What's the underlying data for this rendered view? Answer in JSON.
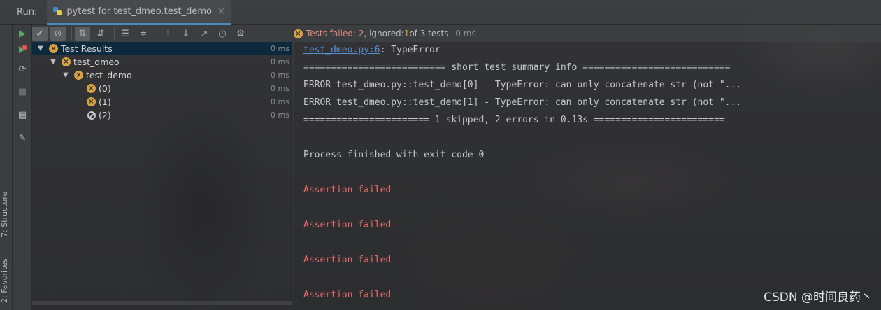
{
  "titlebar": {
    "run_label": "Run:",
    "tab_label": "pytest for test_dmeo.test_demo",
    "close_glyph": "×"
  },
  "side_tabs": {
    "structure": "7: Structure",
    "favorites": "2: Favorites"
  },
  "status": {
    "failed": "Tests failed: 2",
    "ignored_prefix": ", ignored: ",
    "ignored_num": "1",
    "rest": " of 3 tests",
    "time": " – 0 ms"
  },
  "tree": {
    "root": {
      "label": "Test Results",
      "ms": "0 ms"
    },
    "module": {
      "label": "test_dmeo",
      "ms": "0 ms"
    },
    "function": {
      "label": "test_demo",
      "ms": "0 ms"
    },
    "cases": [
      {
        "label": "(0)",
        "ms": "0 ms",
        "status": "error"
      },
      {
        "label": "(1)",
        "ms": "0 ms",
        "status": "error"
      },
      {
        "label": "(2)",
        "ms": "0 ms",
        "status": "skipped"
      }
    ]
  },
  "console": {
    "link": "test_dmeo.py:6",
    "link_suffix": ": TypeError",
    "summary_header": "========================== short test summary info ===========================",
    "error0": "ERROR test_dmeo.py::test_demo[0] - TypeError: can only concatenate str (not \"...",
    "error1": "ERROR test_dmeo.py::test_demo[1] - TypeError: can only concatenate str (not \"...",
    "summary_footer": "======================= 1 skipped, 2 errors in 0.13s ========================",
    "process_finished": "Process finished with exit code 0",
    "assertion_failed": "Assertion failed"
  },
  "watermark": "CSDN @时间良药丶",
  "colors": {
    "accent": "#4a88c7",
    "error_text": "#ef6b6b",
    "warning_icon": "#d9a343",
    "selection": "#0d293e"
  }
}
